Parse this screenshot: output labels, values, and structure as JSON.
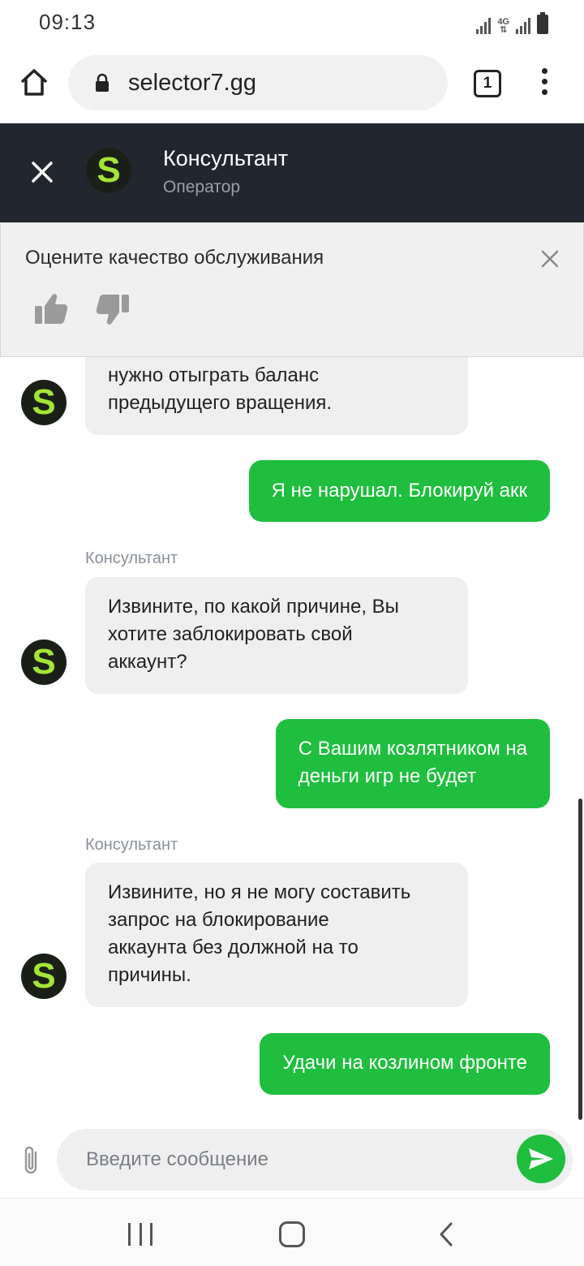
{
  "status_bar": {
    "time": "09:13",
    "network": "4G"
  },
  "browser": {
    "url": "selector7.gg",
    "tab_count": "1"
  },
  "chat_header": {
    "name": "Консультант",
    "role": "Оператор",
    "avatar_letter": "S"
  },
  "rating": {
    "title": "Оцените качество обслуживания"
  },
  "messages": [
    {
      "from": "agent",
      "sender": "",
      "lines": [
        "нужно отыграть баланс",
        "предыдущего вращения."
      ]
    },
    {
      "from": "user",
      "lines": [
        "Я не нарушал. Блокируй акк"
      ]
    },
    {
      "from": "agent",
      "sender": "Консультант",
      "lines": [
        "Извините, по какой причине, Вы",
        "хотите заблокировать свой",
        "аккаунт?"
      ]
    },
    {
      "from": "user",
      "lines": [
        "С Вашим козлятником на",
        "деньги игр не будет"
      ]
    },
    {
      "from": "agent",
      "sender": "Консультант",
      "lines": [
        "Извините, но я не могу составить",
        "запрос на блокирование",
        "аккаунта без должной на то",
        "причины."
      ]
    },
    {
      "from": "user",
      "lines": [
        "Удачи на козлином фронте"
      ]
    }
  ],
  "input": {
    "placeholder": "Введите сообщение"
  },
  "colors": {
    "header_bg": "#22262e",
    "user_bubble": "#1fbe3e",
    "agent_bubble": "#efefef",
    "brand_letter": "#a3e635"
  },
  "icons": [
    "home-icon",
    "lock-icon",
    "tabs-icon",
    "more-vert-icon",
    "close-icon",
    "thumbs-up-icon",
    "thumbs-down-icon",
    "paperclip-icon",
    "send-icon"
  ]
}
